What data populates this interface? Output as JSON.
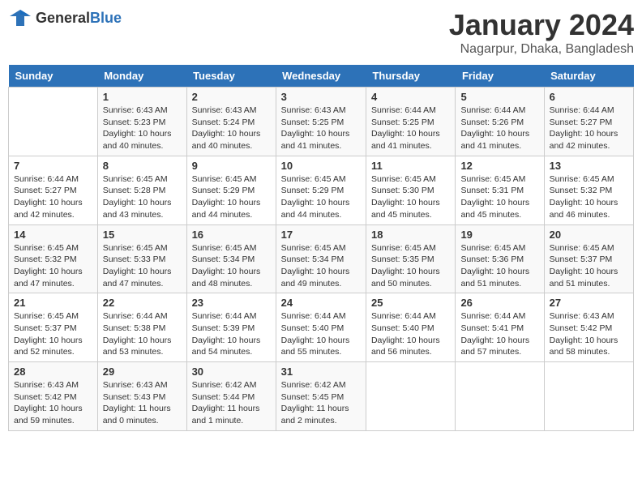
{
  "header": {
    "logo_general": "General",
    "logo_blue": "Blue",
    "month_year": "January 2024",
    "location": "Nagarpur, Dhaka, Bangladesh"
  },
  "days_of_week": [
    "Sunday",
    "Monday",
    "Tuesday",
    "Wednesday",
    "Thursday",
    "Friday",
    "Saturday"
  ],
  "weeks": [
    [
      {
        "day": "",
        "info": ""
      },
      {
        "day": "1",
        "info": "Sunrise: 6:43 AM\nSunset: 5:23 PM\nDaylight: 10 hours\nand 40 minutes."
      },
      {
        "day": "2",
        "info": "Sunrise: 6:43 AM\nSunset: 5:24 PM\nDaylight: 10 hours\nand 40 minutes."
      },
      {
        "day": "3",
        "info": "Sunrise: 6:43 AM\nSunset: 5:25 PM\nDaylight: 10 hours\nand 41 minutes."
      },
      {
        "day": "4",
        "info": "Sunrise: 6:44 AM\nSunset: 5:25 PM\nDaylight: 10 hours\nand 41 minutes."
      },
      {
        "day": "5",
        "info": "Sunrise: 6:44 AM\nSunset: 5:26 PM\nDaylight: 10 hours\nand 41 minutes."
      },
      {
        "day": "6",
        "info": "Sunrise: 6:44 AM\nSunset: 5:27 PM\nDaylight: 10 hours\nand 42 minutes."
      }
    ],
    [
      {
        "day": "7",
        "info": "Sunrise: 6:44 AM\nSunset: 5:27 PM\nDaylight: 10 hours\nand 42 minutes."
      },
      {
        "day": "8",
        "info": "Sunrise: 6:45 AM\nSunset: 5:28 PM\nDaylight: 10 hours\nand 43 minutes."
      },
      {
        "day": "9",
        "info": "Sunrise: 6:45 AM\nSunset: 5:29 PM\nDaylight: 10 hours\nand 44 minutes."
      },
      {
        "day": "10",
        "info": "Sunrise: 6:45 AM\nSunset: 5:29 PM\nDaylight: 10 hours\nand 44 minutes."
      },
      {
        "day": "11",
        "info": "Sunrise: 6:45 AM\nSunset: 5:30 PM\nDaylight: 10 hours\nand 45 minutes."
      },
      {
        "day": "12",
        "info": "Sunrise: 6:45 AM\nSunset: 5:31 PM\nDaylight: 10 hours\nand 45 minutes."
      },
      {
        "day": "13",
        "info": "Sunrise: 6:45 AM\nSunset: 5:32 PM\nDaylight: 10 hours\nand 46 minutes."
      }
    ],
    [
      {
        "day": "14",
        "info": "Sunrise: 6:45 AM\nSunset: 5:32 PM\nDaylight: 10 hours\nand 47 minutes."
      },
      {
        "day": "15",
        "info": "Sunrise: 6:45 AM\nSunset: 5:33 PM\nDaylight: 10 hours\nand 47 minutes."
      },
      {
        "day": "16",
        "info": "Sunrise: 6:45 AM\nSunset: 5:34 PM\nDaylight: 10 hours\nand 48 minutes."
      },
      {
        "day": "17",
        "info": "Sunrise: 6:45 AM\nSunset: 5:34 PM\nDaylight: 10 hours\nand 49 minutes."
      },
      {
        "day": "18",
        "info": "Sunrise: 6:45 AM\nSunset: 5:35 PM\nDaylight: 10 hours\nand 50 minutes."
      },
      {
        "day": "19",
        "info": "Sunrise: 6:45 AM\nSunset: 5:36 PM\nDaylight: 10 hours\nand 51 minutes."
      },
      {
        "day": "20",
        "info": "Sunrise: 6:45 AM\nSunset: 5:37 PM\nDaylight: 10 hours\nand 51 minutes."
      }
    ],
    [
      {
        "day": "21",
        "info": "Sunrise: 6:45 AM\nSunset: 5:37 PM\nDaylight: 10 hours\nand 52 minutes."
      },
      {
        "day": "22",
        "info": "Sunrise: 6:44 AM\nSunset: 5:38 PM\nDaylight: 10 hours\nand 53 minutes."
      },
      {
        "day": "23",
        "info": "Sunrise: 6:44 AM\nSunset: 5:39 PM\nDaylight: 10 hours\nand 54 minutes."
      },
      {
        "day": "24",
        "info": "Sunrise: 6:44 AM\nSunset: 5:40 PM\nDaylight: 10 hours\nand 55 minutes."
      },
      {
        "day": "25",
        "info": "Sunrise: 6:44 AM\nSunset: 5:40 PM\nDaylight: 10 hours\nand 56 minutes."
      },
      {
        "day": "26",
        "info": "Sunrise: 6:44 AM\nSunset: 5:41 PM\nDaylight: 10 hours\nand 57 minutes."
      },
      {
        "day": "27",
        "info": "Sunrise: 6:43 AM\nSunset: 5:42 PM\nDaylight: 10 hours\nand 58 minutes."
      }
    ],
    [
      {
        "day": "28",
        "info": "Sunrise: 6:43 AM\nSunset: 5:42 PM\nDaylight: 10 hours\nand 59 minutes."
      },
      {
        "day": "29",
        "info": "Sunrise: 6:43 AM\nSunset: 5:43 PM\nDaylight: 11 hours\nand 0 minutes."
      },
      {
        "day": "30",
        "info": "Sunrise: 6:42 AM\nSunset: 5:44 PM\nDaylight: 11 hours\nand 1 minute."
      },
      {
        "day": "31",
        "info": "Sunrise: 6:42 AM\nSunset: 5:45 PM\nDaylight: 11 hours\nand 2 minutes."
      },
      {
        "day": "",
        "info": ""
      },
      {
        "day": "",
        "info": ""
      },
      {
        "day": "",
        "info": ""
      }
    ]
  ]
}
